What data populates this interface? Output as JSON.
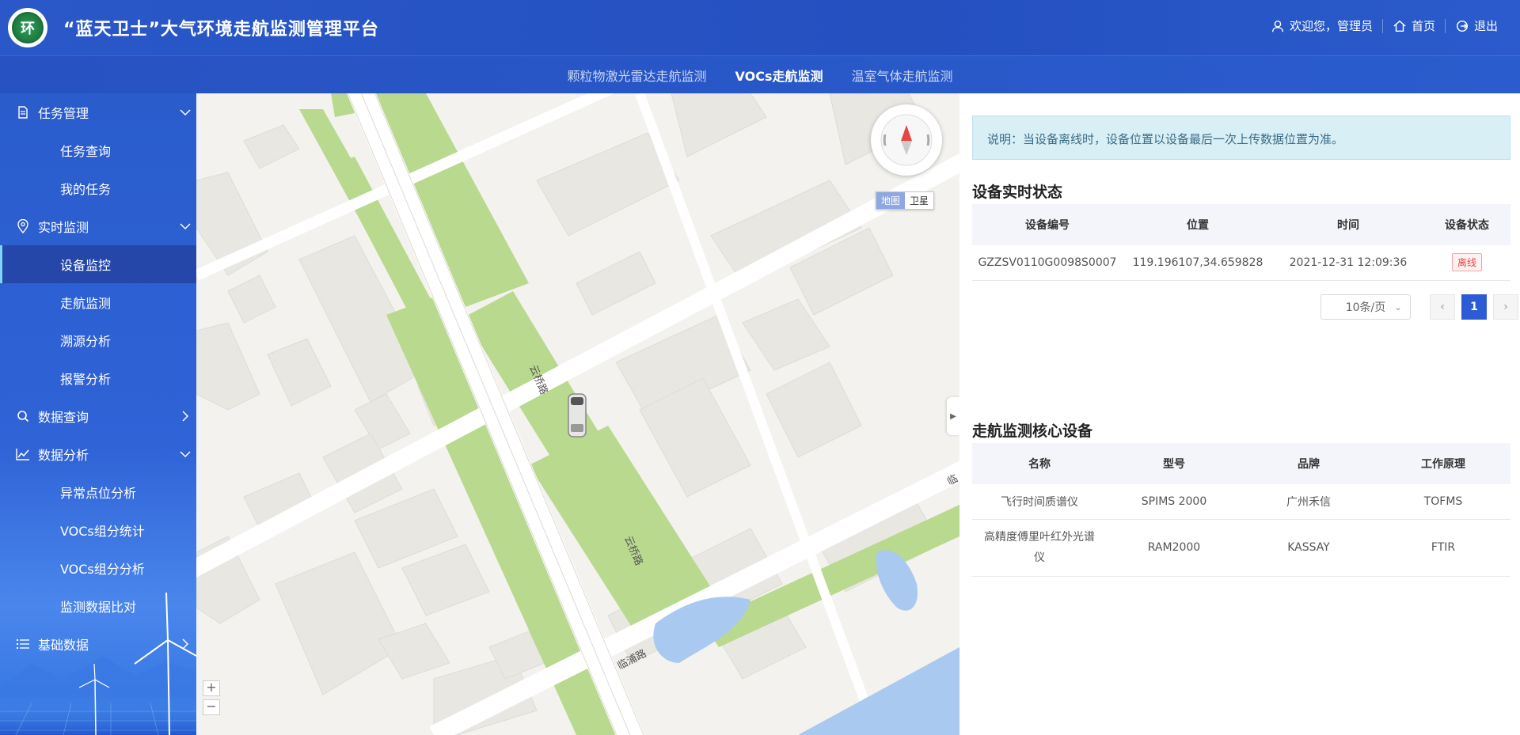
{
  "app": {
    "title": "“蓝天卫士”大气环境走航监测管理平台",
    "logo_text": "环"
  },
  "header": {
    "welcome": "欢迎您，管理员",
    "home": "首页",
    "logout": "退出"
  },
  "topnav": {
    "tabs": [
      {
        "label": "颗粒物激光雷达走航监测",
        "active": false
      },
      {
        "label": "VOCs走航监测",
        "active": true
      },
      {
        "label": "温室气体走航监测",
        "active": false
      }
    ]
  },
  "sidebar": {
    "groups": [
      {
        "label": "任务管理",
        "icon": "document-icon",
        "items": [
          "任务查询",
          "我的任务"
        ]
      },
      {
        "label": "实时监测",
        "icon": "location-pin-icon",
        "items": [
          "设备监控",
          "走航监测",
          "溯源分析",
          "报警分析"
        ]
      },
      {
        "label": "数据查询",
        "icon": "search-icon",
        "items": []
      },
      {
        "label": "数据分析",
        "icon": "chart-line-icon",
        "items": [
          "异常点位分析",
          "VOCs组分统计",
          "VOCs组分分析",
          "监测数据比对"
        ]
      },
      {
        "label": "基础数据",
        "icon": "list-icon",
        "items": []
      }
    ],
    "active_item": "设备监控"
  },
  "map": {
    "type_map": "地图",
    "type_satellite": "卫星",
    "zoom_in": "+",
    "zoom_out": "−",
    "road_labels": [
      "云桥路",
      "云桥路",
      "临浦路",
      "临"
    ],
    "colors": {
      "green": "#b9d98f",
      "road": "#ffffff",
      "land": "#f3f2ee",
      "building": "#e9e8e3",
      "water": "#a9c9f0"
    }
  },
  "panel": {
    "notice": "说明：当设备离线时，设备位置以设备最后一次上传数据位置为准。",
    "status_title": "设备实时状态",
    "status_headers": [
      "设备编号",
      "位置",
      "时间",
      "设备状态"
    ],
    "status_rows": [
      {
        "id": "GZZSV0110G0098S0007",
        "position": "119.196107,34.659828",
        "time": "2021-12-31 12:09:36",
        "status": "离线"
      }
    ],
    "pager": {
      "size": "10条/页",
      "prev": "‹",
      "page": "1",
      "next": "›"
    },
    "core_title": "走航监测核心设备",
    "core_headers": [
      "名称",
      "型号",
      "品牌",
      "工作原理"
    ],
    "core_rows": [
      {
        "name": "飞行时间质谱仪",
        "model": "SPIMS 2000",
        "brand": "广州禾信",
        "principle": "TOFMS"
      },
      {
        "name": "高精度傅里叶红外光谱仪",
        "model": "RAM2000",
        "brand": "KASSAY",
        "principle": "FTIR"
      }
    ]
  }
}
